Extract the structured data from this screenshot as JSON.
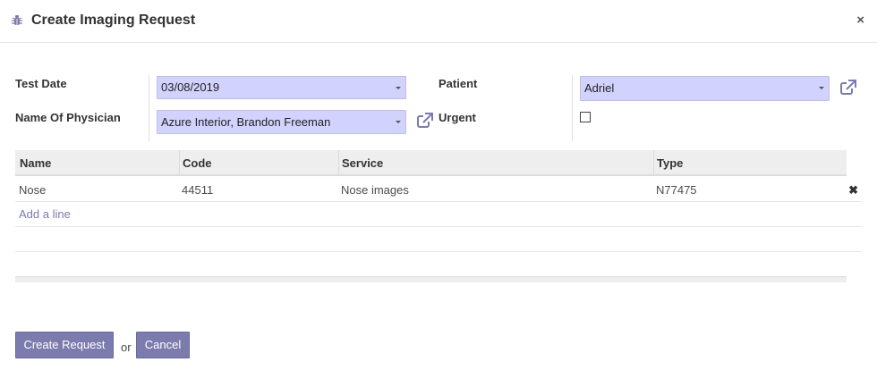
{
  "dialog": {
    "title": "Create Imaging Request",
    "close_glyph": "×"
  },
  "form": {
    "test_date_label": "Test Date",
    "test_date_value": "03/08/2019",
    "physician_label": "Name Of Physician",
    "physician_value": "Azure Interior, Brandon Freeman",
    "patient_label": "Patient",
    "patient_value": "Adriel",
    "urgent_label": "Urgent",
    "urgent_checked": false
  },
  "table": {
    "columns": [
      "Name",
      "Code",
      "Service",
      "Type"
    ],
    "rows": [
      {
        "name": "Nose",
        "code": "44511",
        "service": "Nose images",
        "type": "N77475"
      }
    ],
    "add_line_label": "Add a line",
    "delete_glyph": "✖"
  },
  "footer": {
    "create_label": "Create Request",
    "or_label": "or",
    "cancel_label": "Cancel"
  },
  "colors": {
    "accent": "#7c7bad",
    "field_bg": "#d2d2ff"
  },
  "icons": {
    "title": "bug-icon",
    "close": "close-icon",
    "external": "external-link-icon",
    "dropdown": "caret-down-icon",
    "delete": "delete-icon"
  }
}
